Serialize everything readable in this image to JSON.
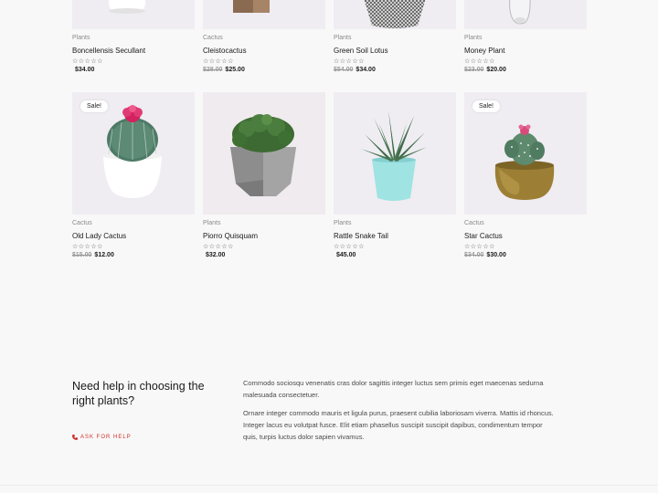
{
  "row1": [
    {
      "category": "Plants",
      "name": "Boncellensis Secullant",
      "rating": "☆☆☆☆☆",
      "old_price": "",
      "price": "$34.00"
    },
    {
      "category": "Cactus",
      "name": "Cleistocactus",
      "rating": "☆☆☆☆☆",
      "old_price": "$28.00",
      "price": "$25.00"
    },
    {
      "category": "Plants",
      "name": "Green Soil Lotus",
      "rating": "☆☆☆☆☆",
      "old_price": "$54.00",
      "price": "$34.00"
    },
    {
      "category": "Plants",
      "name": "Money Plant",
      "rating": "☆☆☆☆☆",
      "old_price": "$23.00",
      "price": "$20.00"
    }
  ],
  "row2": [
    {
      "sale": "Sale!",
      "category": "Cactus",
      "name": "Old Lady Cactus",
      "rating": "☆☆☆☆☆",
      "old_price": "$15.00",
      "price": "$12.00"
    },
    {
      "sale": "",
      "category": "Plants",
      "name": "Piorro Quisquam",
      "rating": "☆☆☆☆☆",
      "old_price": "",
      "price": "$32.00"
    },
    {
      "sale": "",
      "category": "Plants",
      "name": "Rattle Snake Tail",
      "rating": "☆☆☆☆☆",
      "old_price": "",
      "price": "$45.00"
    },
    {
      "sale": "Sale!",
      "category": "Cactus",
      "name": "Star Cactus",
      "rating": "☆☆☆☆☆",
      "old_price": "$34.00",
      "price": "$30.00"
    }
  ],
  "help": {
    "title": "Need help in choosing the right plants?",
    "link_label": "ASK FOR HELP",
    "link_icon": "phone-icon",
    "paragraphs": [
      "Commodo sociosqu venenatis cras dolor sagittis integer luctus sem primis eget maecenas sedurna malesuada consectetuer.",
      "Ornare integer commodo mauris et ligula purus, praesent cubilia laboriosam viverra. Mattis id rhoncus. Integer lacus eu volutpat fusce. Elit etiam phasellus suscipit suscipit dapibus, condimentum tempor quis, turpis luctus dolor sapien vivamus."
    ]
  },
  "colors": {
    "accent": "#d0312d",
    "card_bg": "#efedf2",
    "page_bg": "#f8f8f8"
  }
}
